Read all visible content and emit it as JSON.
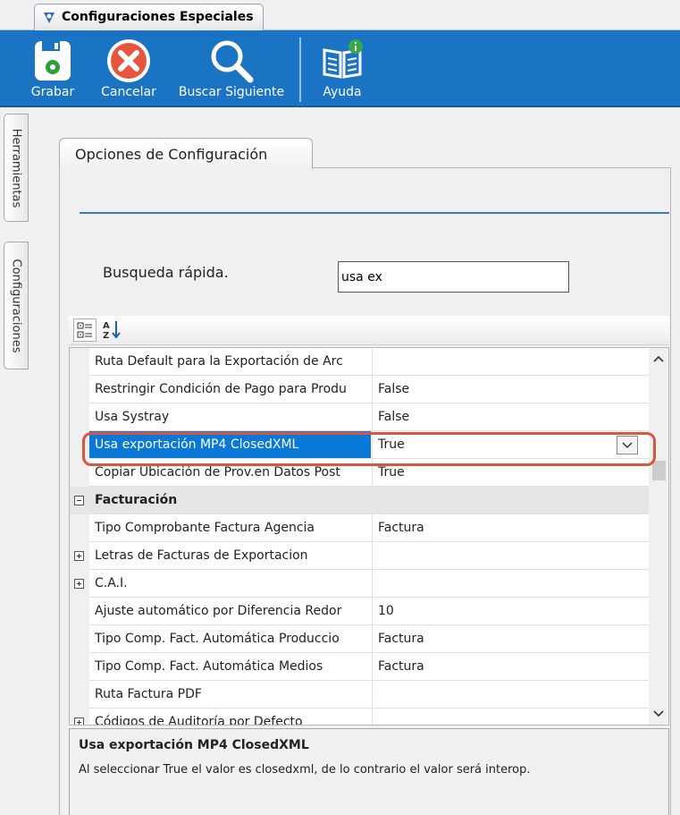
{
  "window": {
    "tab_title": "Configuraciones Especiales"
  },
  "toolbar": {
    "save_label": "Grabar",
    "cancel_label": "Cancelar",
    "find_next_label": "Buscar Siguiente",
    "help_label": "Ayuda",
    "colors": {
      "background": "#1b73c4",
      "text": "#ffffff"
    }
  },
  "side_tabs": {
    "tools": "Herramientas",
    "settings": "Configuraciones"
  },
  "panel": {
    "tab_label": "Opciones de Configuración",
    "search_label": "Busqueda rápida.",
    "search_value": "usa ex"
  },
  "grid": {
    "rows": [
      {
        "name": "Ruta Default para la Exportación de Arc",
        "value": ""
      },
      {
        "name": "Restringir Condición de Pago para Produ",
        "value": "False"
      },
      {
        "name": "Usa Systray",
        "value": "False"
      },
      {
        "name": "Usa exportación MP4 ClosedXML",
        "value": "True",
        "selected": true
      },
      {
        "name": "Copiar Ubicación de Prov.en Datos Post",
        "value": "True"
      },
      {
        "name": "Facturación",
        "category": true
      },
      {
        "name": "Tipo Comprobante Factura Agencia",
        "value": "Factura"
      },
      {
        "name": "Letras de Facturas de Exportacion",
        "value": "",
        "expandable": true
      },
      {
        "name": "C.A.I.",
        "value": "",
        "expandable": true
      },
      {
        "name": "Ajuste automático por Diferencia Redor",
        "value": "10"
      },
      {
        "name": "Tipo Comp. Fact. Automática Produccio",
        "value": "Factura"
      },
      {
        "name": "Tipo Comp. Fact. Automática Medios",
        "value": "Factura"
      },
      {
        "name": "Ruta Factura PDF",
        "value": ""
      },
      {
        "name": "Códigos de Auditoría por Defecto",
        "value": "",
        "expandable": true
      }
    ],
    "colors": {
      "selection": "#0a78d7",
      "highlight_border": "#d9563f"
    }
  },
  "help": {
    "title": "Usa exportación MP4 ClosedXML",
    "text": "Al seleccionar True el valor es closedxml, de lo contrario el valor será interop."
  }
}
